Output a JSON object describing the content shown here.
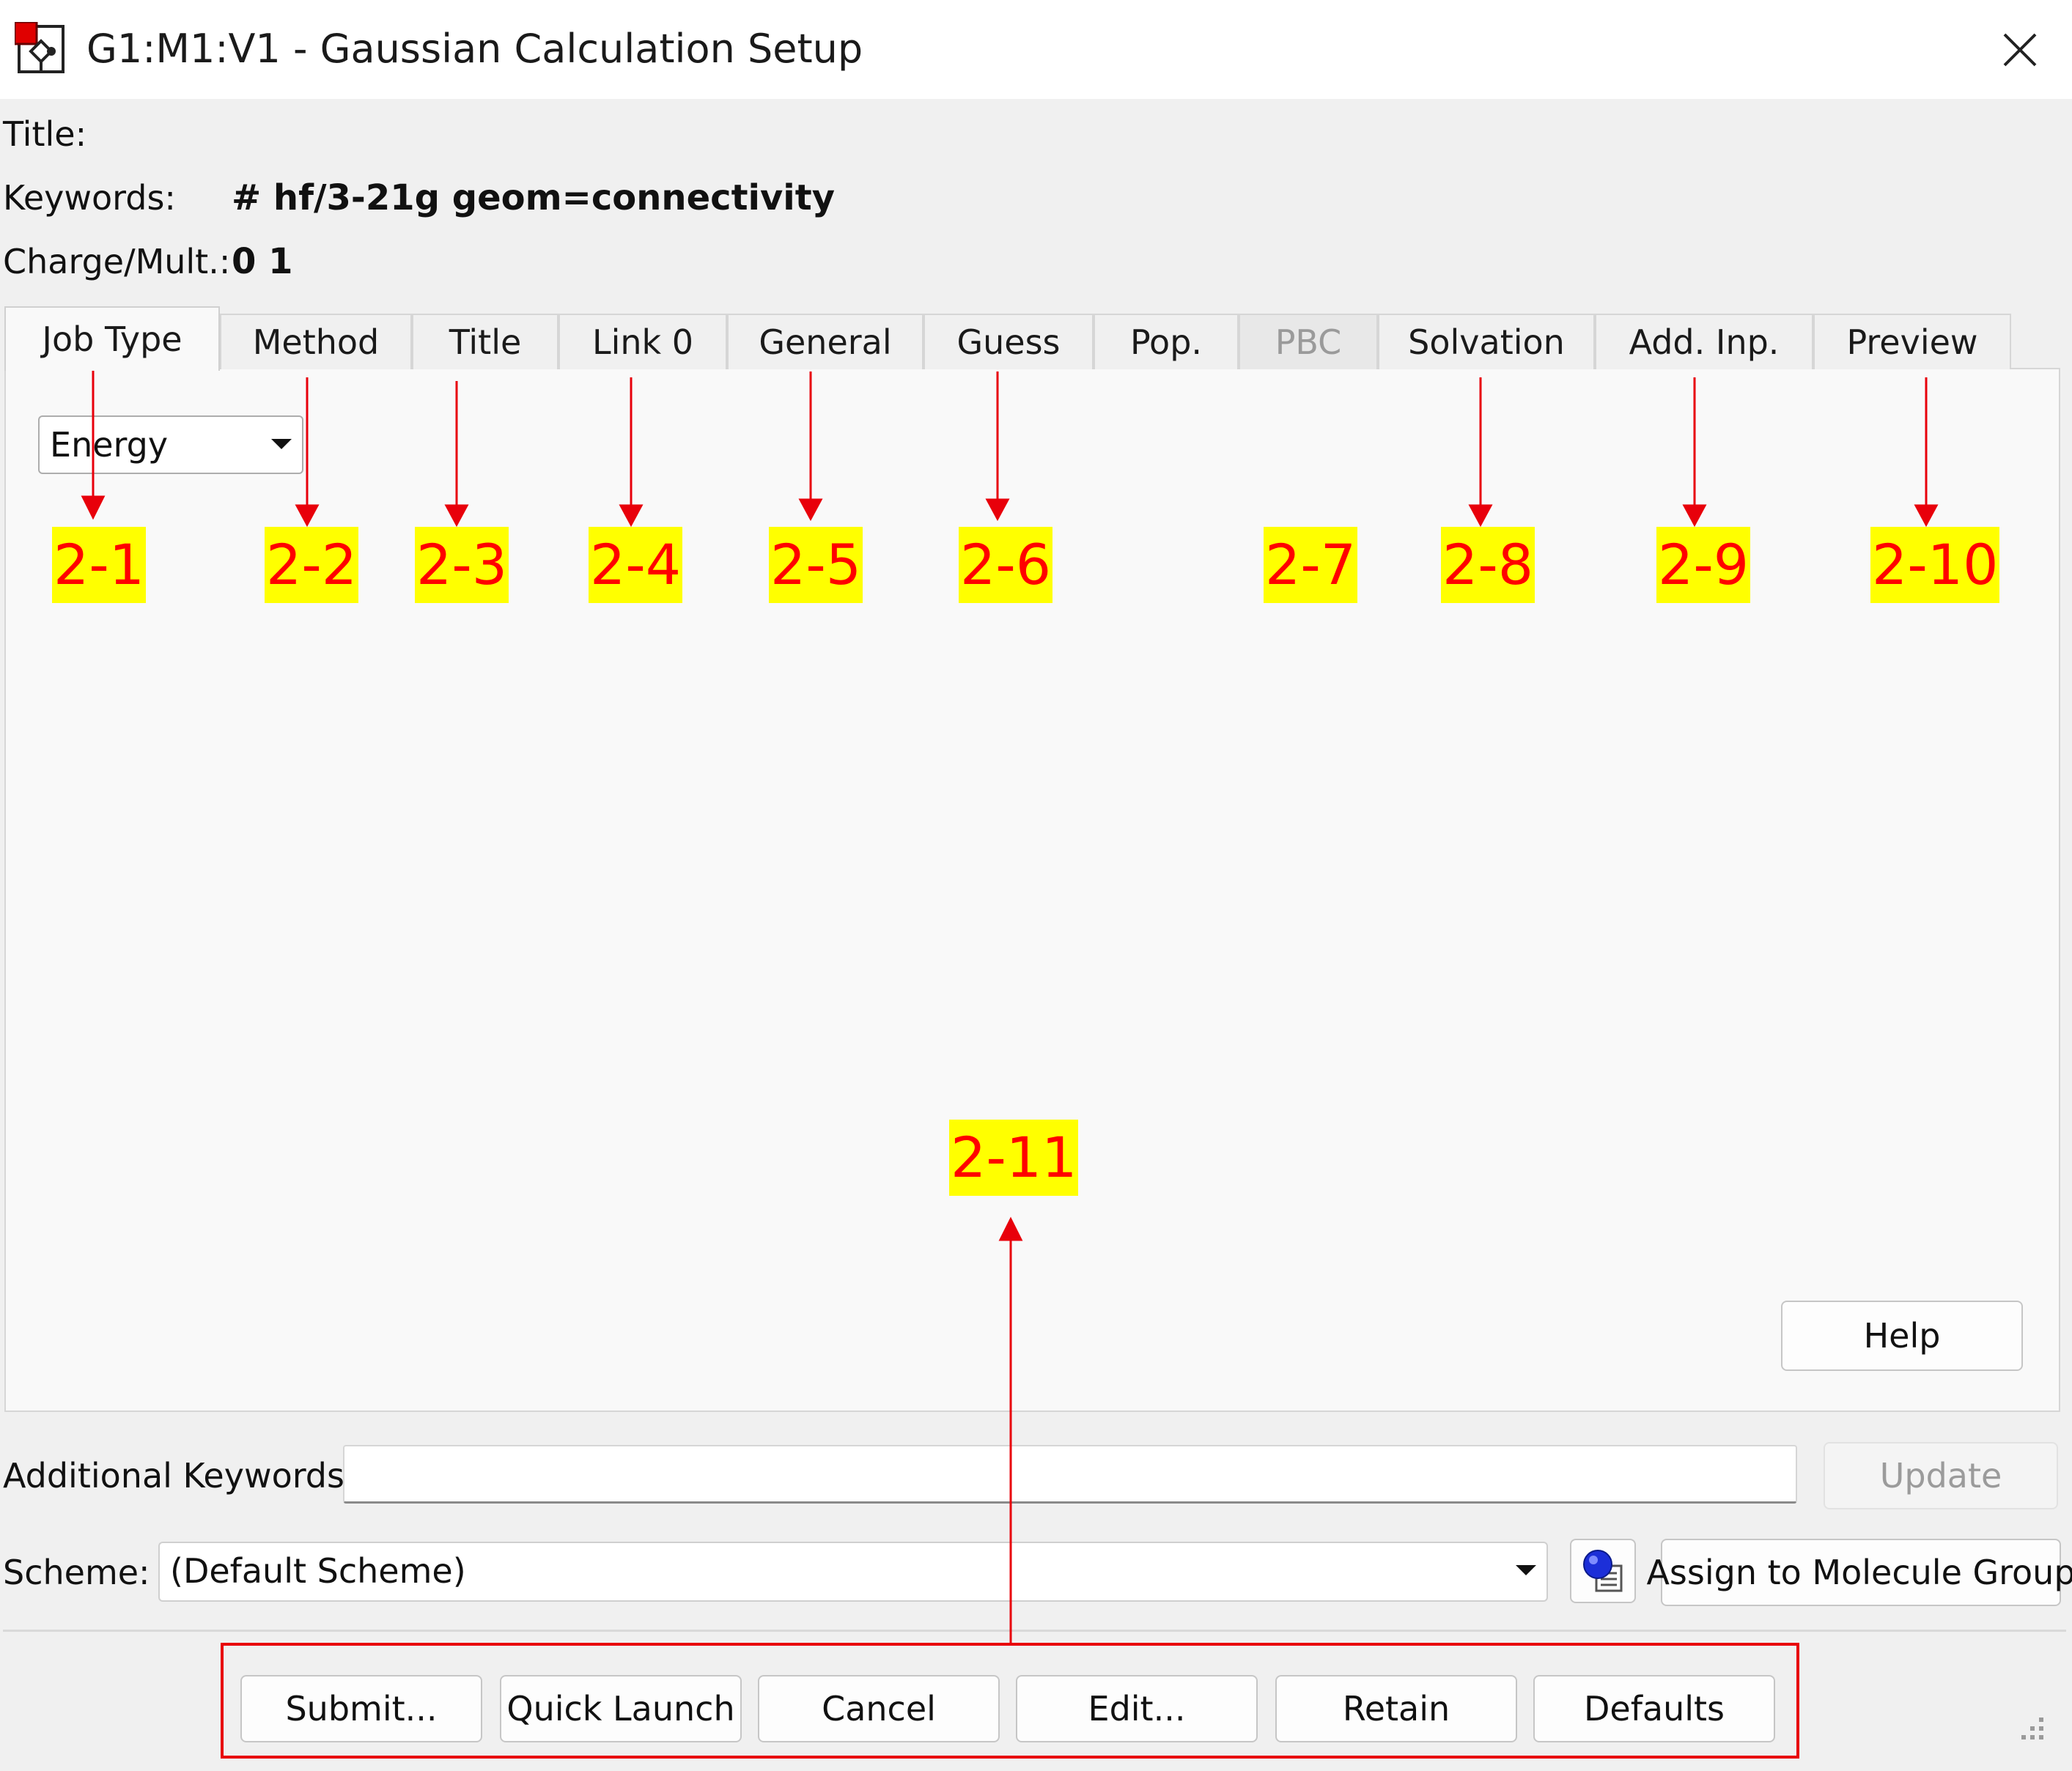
{
  "window": {
    "title": "G1:M1:V1 - Gaussian Calculation Setup"
  },
  "header": {
    "title_label": "Title:",
    "title_value": "",
    "keywords_label": "Keywords:",
    "keywords_value": "# hf/3-21g geom=connectivity",
    "charge_label": "Charge/Mult.:",
    "charge_value": "0 1"
  },
  "tabs": [
    {
      "label": "Job Type",
      "state": "active"
    },
    {
      "label": "Method",
      "state": "normal"
    },
    {
      "label": "Title",
      "state": "normal"
    },
    {
      "label": "Link 0",
      "state": "normal"
    },
    {
      "label": "General",
      "state": "normal"
    },
    {
      "label": "Guess",
      "state": "normal"
    },
    {
      "label": "Pop.",
      "state": "normal"
    },
    {
      "label": "PBC",
      "state": "disabled"
    },
    {
      "label": "Solvation",
      "state": "normal"
    },
    {
      "label": "Add. Inp.",
      "state": "normal"
    },
    {
      "label": "Preview",
      "state": "normal"
    }
  ],
  "job_type": {
    "selected": "Energy"
  },
  "panel": {
    "help_label": "Help"
  },
  "additional_keywords": {
    "label": "Additional Keywords:",
    "value": "",
    "update_label": "Update"
  },
  "scheme": {
    "label": "Scheme:",
    "selected": "(Default Scheme)",
    "assign_label": "Assign to Molecule Group"
  },
  "footer_buttons": [
    "Submit...",
    "Quick Launch",
    "Cancel",
    "Edit...",
    "Retain",
    "Defaults"
  ],
  "annotations": [
    "2-1",
    "2-2",
    "2-3",
    "2-4",
    "2-5",
    "2-6",
    "2-7",
    "2-8",
    "2-9",
    "2-10",
    "2-11"
  ],
  "colors": {
    "annotation_text": "#ff0000",
    "annotation_fill": "#ffff00",
    "annotation_line": "#e8000b"
  }
}
